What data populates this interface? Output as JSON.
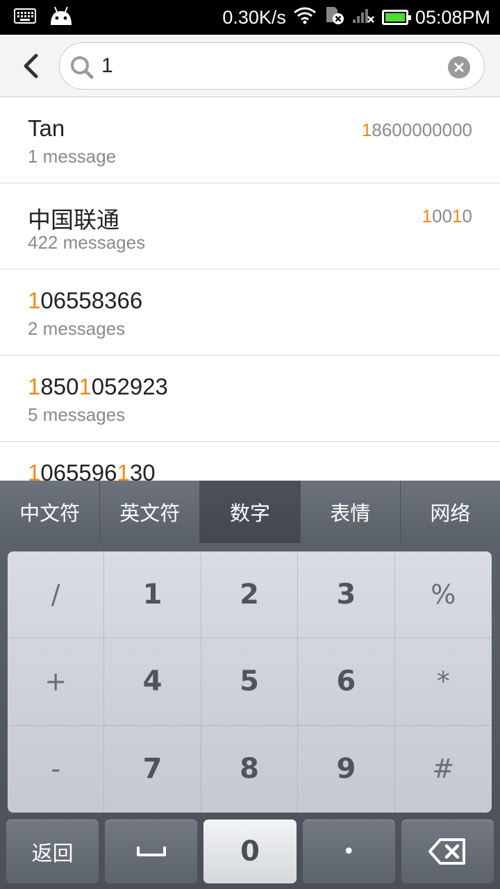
{
  "status_bar": {
    "network_speed": "0.30K/s",
    "time": "05:08PM",
    "icons": [
      "keyboard-icon",
      "android-icon",
      "wifi-icon",
      "sim-card-icon",
      "signal-icon",
      "battery-icon"
    ],
    "battery_color": "#4ddb2e"
  },
  "search": {
    "query": "1"
  },
  "results": [
    {
      "name_plain": "Tan",
      "number_hl": "1",
      "number_rest": "8600000000",
      "count": "1 message"
    },
    {
      "name_plain": "中国联通",
      "number_hl": "1",
      "number_mid": "00",
      "number_hl2": "1",
      "number_rest": "0",
      "count": "422 messages"
    },
    {
      "name_hl": "1",
      "name_rest": "06558366",
      "count": "2 messages"
    },
    {
      "name_hl": "1",
      "name_mid": "850",
      "name_hl2": "1",
      "name_rest": "052923",
      "count": "5 messages"
    },
    {
      "name_hl": "1",
      "name_mid": "065596",
      "name_hl2": "1",
      "name_rest": "30"
    }
  ],
  "highlight_color": "#f08a16",
  "keyboard": {
    "tabs": [
      "中文符",
      "英文符",
      "数字",
      "表情",
      "网络"
    ],
    "active_tab": "数字",
    "keys": [
      "/",
      "1",
      "2",
      "3",
      "%",
      "+",
      "4",
      "5",
      "6",
      "*",
      "-",
      "7",
      "8",
      "9",
      "#"
    ],
    "bottom": {
      "back": "返回",
      "zero": "0",
      "dot": "•"
    }
  }
}
